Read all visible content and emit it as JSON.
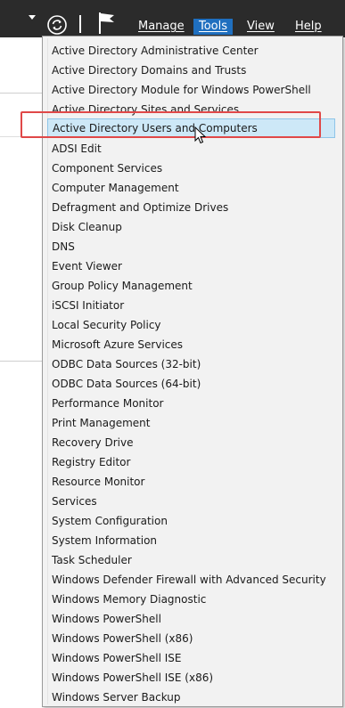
{
  "menubar": {
    "items": [
      {
        "label": "Manage",
        "active": false
      },
      {
        "label": "Tools",
        "active": true
      },
      {
        "label": "View",
        "active": false
      },
      {
        "label": "Help",
        "active": false
      }
    ],
    "icons": [
      "dropdown-arrow-icon",
      "refresh-icon",
      "notification-flag-icon"
    ]
  },
  "tools_menu": {
    "items": [
      "Active Directory Administrative Center",
      "Active Directory Domains and Trusts",
      "Active Directory Module for Windows PowerShell",
      "Active Directory Sites and Services",
      "Active Directory Users and Computers",
      "ADSI Edit",
      "Component Services",
      "Computer Management",
      "Defragment and Optimize Drives",
      "Disk Cleanup",
      "DNS",
      "Event Viewer",
      "Group Policy Management",
      "iSCSI Initiator",
      "Local Security Policy",
      "Microsoft Azure Services",
      "ODBC Data Sources (32-bit)",
      "ODBC Data Sources (64-bit)",
      "Performance Monitor",
      "Print Management",
      "Recovery Drive",
      "Registry Editor",
      "Resource Monitor",
      "Services",
      "System Configuration",
      "System Information",
      "Task Scheduler",
      "Windows Defender Firewall with Advanced Security",
      "Windows Memory Diagnostic",
      "Windows PowerShell",
      "Windows PowerShell (x86)",
      "Windows PowerShell ISE",
      "Windows PowerShell ISE (x86)",
      "Windows Server Backup"
    ],
    "highlighted_index": 4
  },
  "colors": {
    "menubar_bg": "#2b2b2b",
    "active_menu_bg": "#1f6fbf",
    "highlight_bg": "#cde8f7",
    "annotation_border": "#e04848"
  }
}
